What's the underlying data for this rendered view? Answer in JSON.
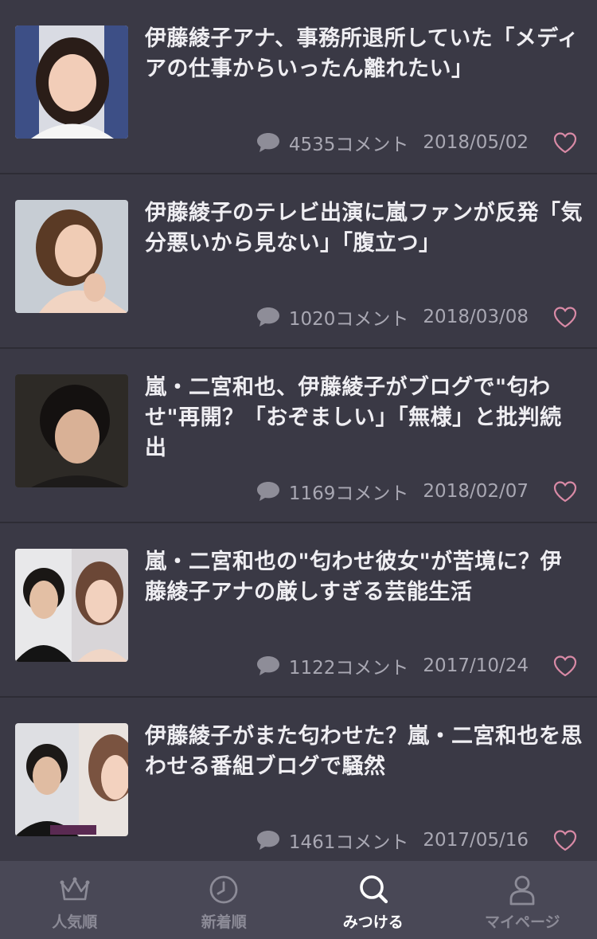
{
  "articles": [
    {
      "title": "伊藤綾子アナ、事務所退所していた「メディアの仕事からいったん離れたい」",
      "comments": "4535コメント",
      "date": "2018/05/02"
    },
    {
      "title": "伊藤綾子のテレビ出演に嵐ファンが反発「気分悪いから見ない」「腹立つ」",
      "comments": "1020コメント",
      "date": "2018/03/08"
    },
    {
      "title": "嵐・二宮和也、伊藤綾子がブログで\"匂わせ\"再開？「おぞましい」「無様」と批判続出",
      "comments": "1169コメント",
      "date": "2018/02/07"
    },
    {
      "title": "嵐・二宮和也の\"匂わせ彼女\"が苦境に？伊藤綾子アナの厳しすぎる芸能生活",
      "comments": "1122コメント",
      "date": "2017/10/24"
    },
    {
      "title": "伊藤綾子がまた匂わせた？嵐・二宮和也を思わせる番組ブログで騒然",
      "comments": "1461コメント",
      "date": "2017/05/16"
    }
  ],
  "tabs": [
    {
      "label": "人気順",
      "icon": "crown-icon"
    },
    {
      "label": "新着順",
      "icon": "clock-icon"
    },
    {
      "label": "みつける",
      "icon": "search-icon"
    },
    {
      "label": "マイページ",
      "icon": "user-icon"
    }
  ],
  "active_tab": "みつける",
  "colors": {
    "background": "#3a3945",
    "tabbar": "#494856",
    "heart": "#d98aa6",
    "meta": "#a9a8b3"
  }
}
